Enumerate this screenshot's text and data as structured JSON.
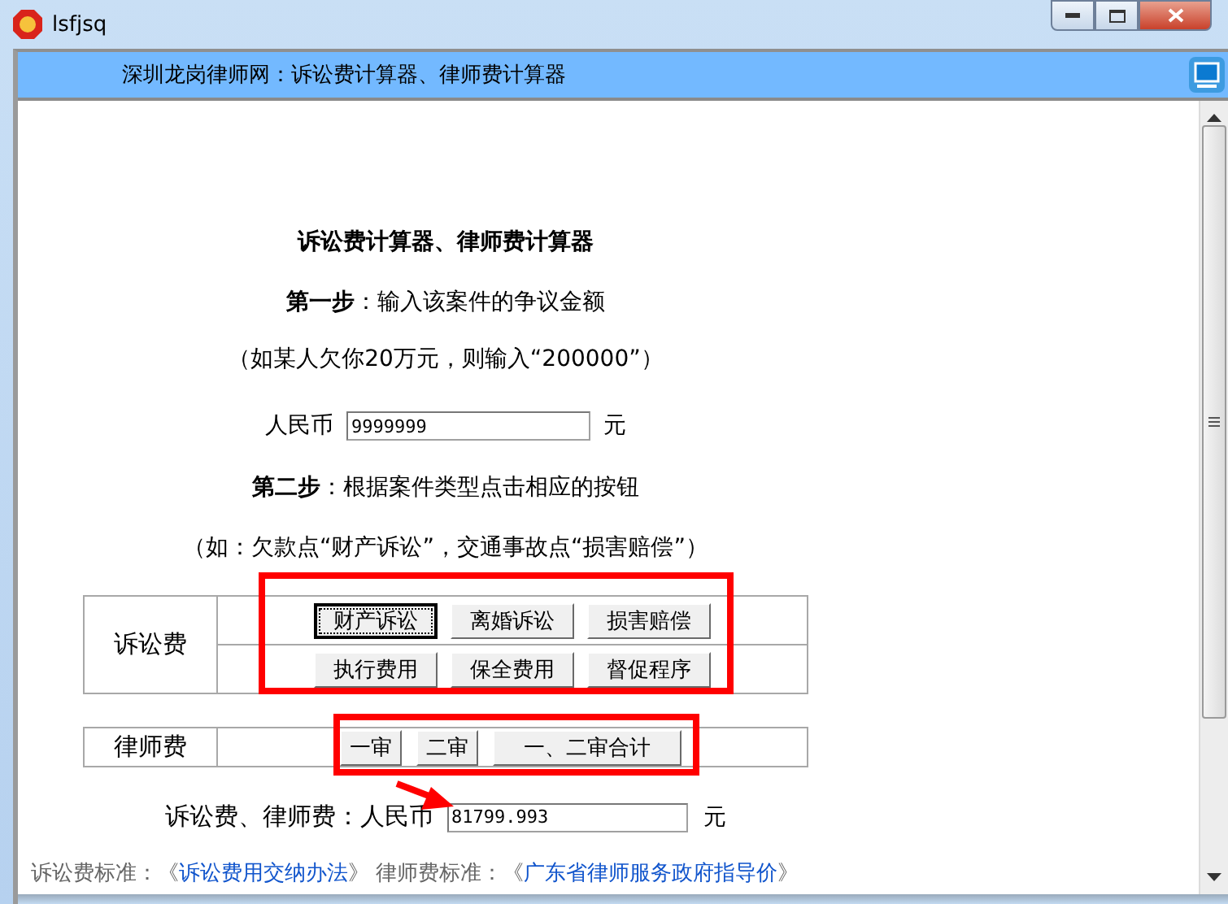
{
  "window": {
    "title": "lsfjsq"
  },
  "header": {
    "title": "深圳龙岗律师网：诉讼费计算器、律师费计算器"
  },
  "page": {
    "title": "诉讼费计算器、律师费计算器",
    "step1": {
      "label": "第一步",
      "text": "：输入该案件的争议金额"
    },
    "hint1": "（如某人欠你20万元，则输入“200000”）",
    "amount": {
      "label": "人民币",
      "value": "9999999",
      "unit": "元"
    },
    "step2": {
      "label": "第二步",
      "text": "：根据案件类型点击相应的按钮"
    },
    "hint2": "（如：欠款点“财产诉讼”，交通事故点“损害赔偿”）",
    "litigation": {
      "label": "诉讼费",
      "rows": [
        [
          {
            "label": "财产诉讼",
            "focused": true
          },
          {
            "label": "离婚诉讼",
            "focused": false
          },
          {
            "label": "损害赔偿",
            "focused": false
          }
        ],
        [
          {
            "label": "执行费用",
            "focused": false
          },
          {
            "label": "保全费用",
            "focused": false
          },
          {
            "label": "督促程序",
            "focused": false
          }
        ]
      ]
    },
    "lawyer": {
      "label": "律师费",
      "buttons": [
        {
          "label": "一审",
          "focused": false
        },
        {
          "label": "二审",
          "focused": false
        },
        {
          "label": "一、二审合计",
          "focused": false
        }
      ]
    },
    "result": {
      "label": "诉讼费、律师费：人民币",
      "value": "81799.993",
      "unit": "元"
    },
    "footer": [
      {
        "kind": "text",
        "text": "诉讼费标准：《"
      },
      {
        "kind": "link",
        "text": "诉讼费用交纳办法"
      },
      {
        "kind": "text",
        "text": "》 律师费标准：《"
      },
      {
        "kind": "link",
        "text": "广东省律师服务政府指导价"
      },
      {
        "kind": "text",
        "text": "》"
      }
    ]
  }
}
